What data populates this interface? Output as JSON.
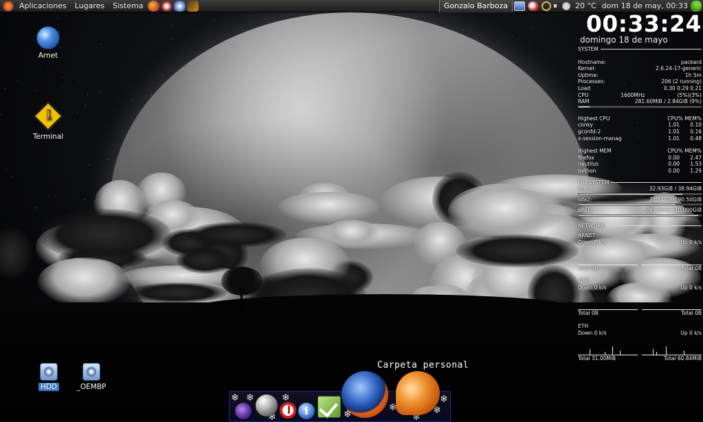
{
  "top_panel": {
    "menus": [
      "Aplicaciones",
      "Lugares",
      "Sistema"
    ],
    "launchers": [
      "firefox-icon",
      "mail-icon",
      "pidgin-icon",
      "bolt-icon"
    ],
    "user_name": "Gonzalo Barboza",
    "temperature": "20 °C",
    "clock": "dom 18 de may, 00:33"
  },
  "desktop_icons": {
    "arnet": "Arnet",
    "terminal": "Terminal",
    "hdd": "HDD",
    "oembp": "_OEMBP"
  },
  "conky": {
    "time": "00:33:24",
    "date": "domingo 18 de mayo",
    "system_header": "SYSTEM",
    "hostname_label": "Hostname:",
    "hostname": "packard",
    "kernel_label": "Kernel:",
    "kernel": "2.6.24-17-generic",
    "uptime_label": "Uptime:",
    "uptime": "1h 5m",
    "processes_label": "Processes:",
    "processes": "206 (2 running)",
    "load_label": "Load",
    "load": "0.30 0.29 0.21",
    "cpu_label": "CPU",
    "cpu_freq": "1600MHz",
    "cpu_usage": "(5%)(3%)",
    "ram_label": "RAM",
    "ram": "281.60MiB / 2.84GiB (9%)",
    "ram_fraction": 0.09,
    "highest_cpu": {
      "header": "Highest CPU",
      "cols": "CPU% MEM%",
      "rows": [
        {
          "name": "conky",
          "cpu": "1.01",
          "mem": "0.10"
        },
        {
          "name": "gconfd-2",
          "cpu": "1.01",
          "mem": "0.16"
        },
        {
          "name": "x-session-manag",
          "cpu": "1.01",
          "mem": "0.48"
        }
      ]
    },
    "highest_mem": {
      "header": "Highest MEM",
      "cols": "CPU% MEM%",
      "rows": [
        {
          "name": "firefox",
          "cpu": "0.00",
          "mem": "2.47"
        },
        {
          "name": "nautilus",
          "cpu": "0.00",
          "mem": "1.53"
        },
        {
          "name": "python",
          "cpu": "0.00",
          "mem": "1.29"
        }
      ]
    },
    "filesystem_header": "FILESYSTEM",
    "home_label": "Home:",
    "home": "32.93GiB / 38.94GiB",
    "home_fraction": 0.85,
    "sda2_label": "sda2:",
    "sda2": "71.54GiB / 90.50GiB",
    "sda2_fraction": 0.79,
    "sda1_label": "sda1:",
    "sda1": "245.0GiB / 10.000GiB",
    "sda1_fraction": 0.98,
    "network_header": "NETWORK",
    "arnet_label": "ARNET",
    "arnet_down": "Down 0 k/s",
    "arnet_up": "Up 0 k/s",
    "arnet_total_down": "Total 0B",
    "arnet_total_up": "Total 0B",
    "wifi_label": "WIFI",
    "wifi_down": "Down 0 k/s",
    "wifi_up": "Up 0 k/s",
    "wifi_total_down": "Total 0B",
    "wifi_total_up": "Total 0B",
    "eth_label": "ETH",
    "eth_down": "Down 0 k/s",
    "eth_up": "Up 0 k/s",
    "eth_total_down": "Total 31.00MiB",
    "eth_total_up": "Total 60.84MiB"
  },
  "dock": {
    "title": "Carpeta personal",
    "items": [
      "purple-orb-icon",
      "chrome-sphere-icon",
      "power-icon",
      "info-icon",
      "tasks-check-icon",
      "firefox-icon",
      "home-folder-shell-icon"
    ]
  }
}
